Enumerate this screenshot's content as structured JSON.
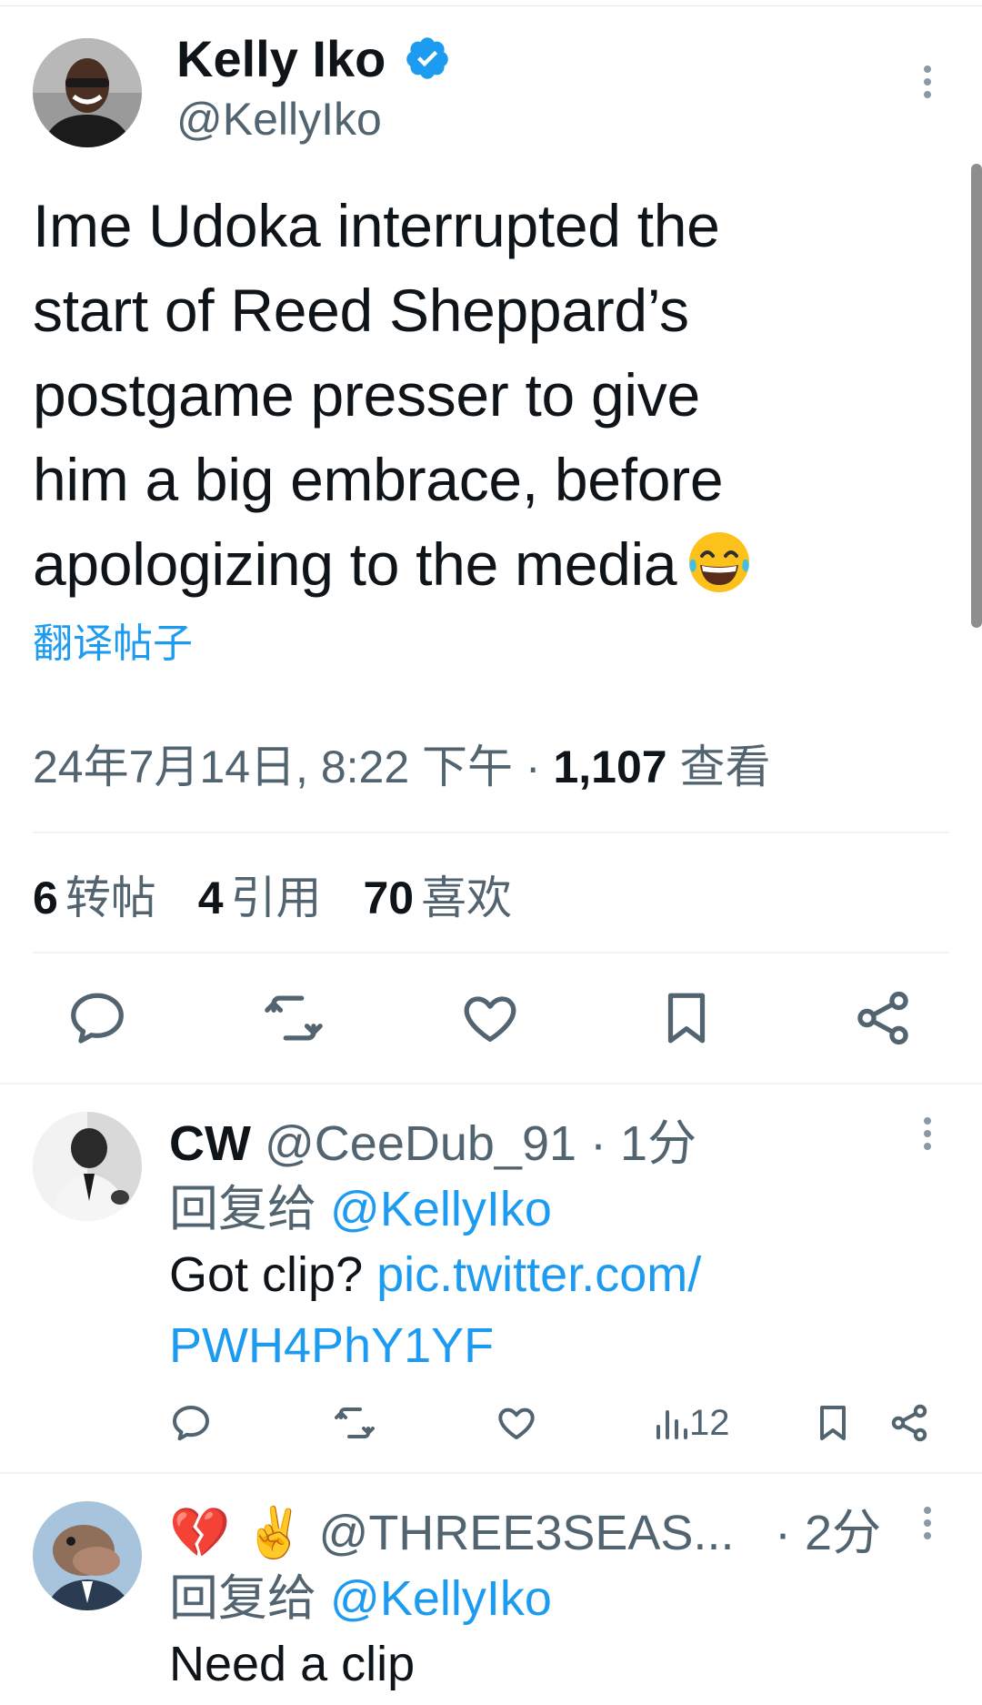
{
  "tweet": {
    "author_name": "Kelly Iko",
    "author_handle": "@KellyIko",
    "text_lines": [
      "Ime Udoka interrupted the",
      "start of Reed Sheppard’s",
      "postgame presser to give",
      "him a big embrace, before",
      "apologizing to the media"
    ],
    "translate_label": "翻译帖子",
    "timestamp": "24年7月14日, 8:22 下午",
    "dot": " · ",
    "views_count": "1,107",
    "views_label": "查看",
    "stats": {
      "reposts_count": "6",
      "reposts_label": "转帖",
      "quotes_count": "4",
      "quotes_label": "引用",
      "likes_count": "70",
      "likes_label": "喜欢"
    }
  },
  "replies": [
    {
      "name": "CW",
      "handle": "@CeeDub_91",
      "time": "· 1分",
      "reply_to_label": "回复给",
      "reply_to_handle": "@KellyIko",
      "text": "Got clip?",
      "link_line1": "pic.twitter.com/",
      "link_line2": "PWH4PhY1YF",
      "views": "12"
    },
    {
      "name_emojis": "💔 ✌️",
      "handle": "@THREE3SEAS...",
      "time": "· 2分",
      "reply_to_label": "回复给",
      "reply_to_handle": "@KellyIko",
      "text": "Need a clip"
    }
  ],
  "colors": {
    "accent": "#1d9bf0",
    "secondary_text": "#536471",
    "primary_text": "#0f1419",
    "divider": "#eff3f4"
  },
  "icons": [
    "verified-badge-icon",
    "more-icon",
    "reply-icon",
    "repost-icon",
    "like-icon",
    "bookmark-icon",
    "share-icon",
    "views-icon",
    "laughing-emoji-icon"
  ]
}
